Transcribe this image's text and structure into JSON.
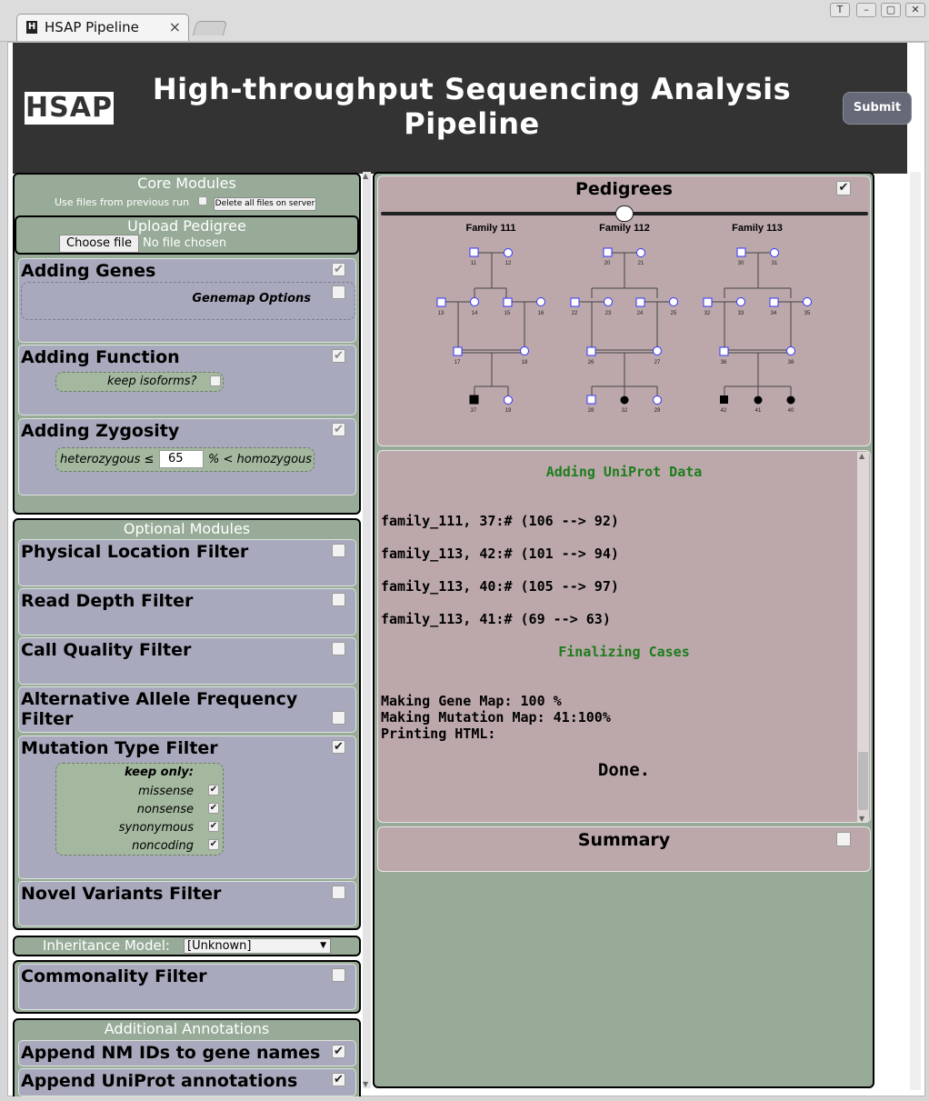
{
  "window": {
    "tab_title": "HSAP Pipeline",
    "tab_close": "×",
    "controls": [
      "T",
      "–",
      "▢",
      "✕"
    ]
  },
  "header": {
    "logo": "HSAP",
    "title": "High-throughput Sequencing Analysis Pipeline",
    "submit_label": "Submit"
  },
  "core": {
    "title": "Core Modules",
    "use_files_label": "Use files from previous run",
    "delete_label": "Delete all files on server",
    "upload": {
      "title": "Upload Pedigree",
      "choose_label": "Choose file",
      "no_file": "No file chosen"
    },
    "adding_genes": {
      "title": "Adding Genes",
      "checked": true,
      "genemap_label": "Genemap Options"
    },
    "adding_function": {
      "title": "Adding Function",
      "checked": true,
      "isoforms_label": "keep isoforms?"
    },
    "adding_zygosity": {
      "title": "Adding Zygosity",
      "checked": true,
      "het_label": "heterozygous ≤",
      "value": "65",
      "hom_label": "% < homozygous"
    }
  },
  "optional": {
    "title": "Optional Modules",
    "physical_location": {
      "title": "Physical Location Filter",
      "checked": false
    },
    "read_depth": {
      "title": "Read Depth Filter",
      "checked": false
    },
    "call_quality": {
      "title": "Call Quality Filter",
      "checked": false
    },
    "alt_allele": {
      "title": "Alternative Allele Frequency Filter",
      "checked": false
    },
    "mutation_type": {
      "title": "Mutation Type Filter",
      "checked": true,
      "keep_only": "keep only:",
      "options": [
        {
          "label": "missense",
          "checked": true
        },
        {
          "label": "nonsense",
          "checked": true
        },
        {
          "label": "synonymous",
          "checked": true
        },
        {
          "label": "noncoding",
          "checked": true
        }
      ]
    },
    "novel_variants": {
      "title": "Novel Variants Filter",
      "checked": false
    }
  },
  "inheritance": {
    "label": "Inheritance Model:",
    "selected": "[Unknown]"
  },
  "commonality": {
    "title": "Commonality Filter",
    "checked": false
  },
  "additional": {
    "title": "Additional Annotations",
    "nm_ids": {
      "title": "Append NM IDs to gene names",
      "checked": true
    },
    "uniprot": {
      "title": "Append UniProt annotations",
      "checked": true
    }
  },
  "pedigrees": {
    "title": "Pedigrees",
    "checked": true,
    "families": [
      {
        "name": "Family 111",
        "ids": [
          "11",
          "12",
          "13",
          "14",
          "15",
          "16",
          "17",
          "18",
          "37",
          "19"
        ]
      },
      {
        "name": "Family 112",
        "ids": [
          "20",
          "21",
          "22",
          "23",
          "24",
          "25",
          "26",
          "27",
          "28",
          "32",
          "29"
        ]
      },
      {
        "name": "Family 113",
        "ids": [
          "30",
          "31",
          "32",
          "33",
          "34",
          "35",
          "36",
          "38",
          "42",
          "41",
          "40"
        ]
      }
    ]
  },
  "log": {
    "heading1": "Adding UniProt Data",
    "lines": [
      "family_111, 37:# (106 --> 92)",
      "family_113, 42:# (101 --> 94)",
      "family_113, 40:# (105 --> 97)",
      "family_113, 41:# (69 --> 63)"
    ],
    "heading2": "Finalizing Cases",
    "progress": [
      "Making Gene Map: 100 %",
      "Making Mutation Map: 41:100%",
      "Printing HTML:"
    ],
    "done": "Done."
  },
  "summary": {
    "title": "Summary",
    "checked": false
  }
}
